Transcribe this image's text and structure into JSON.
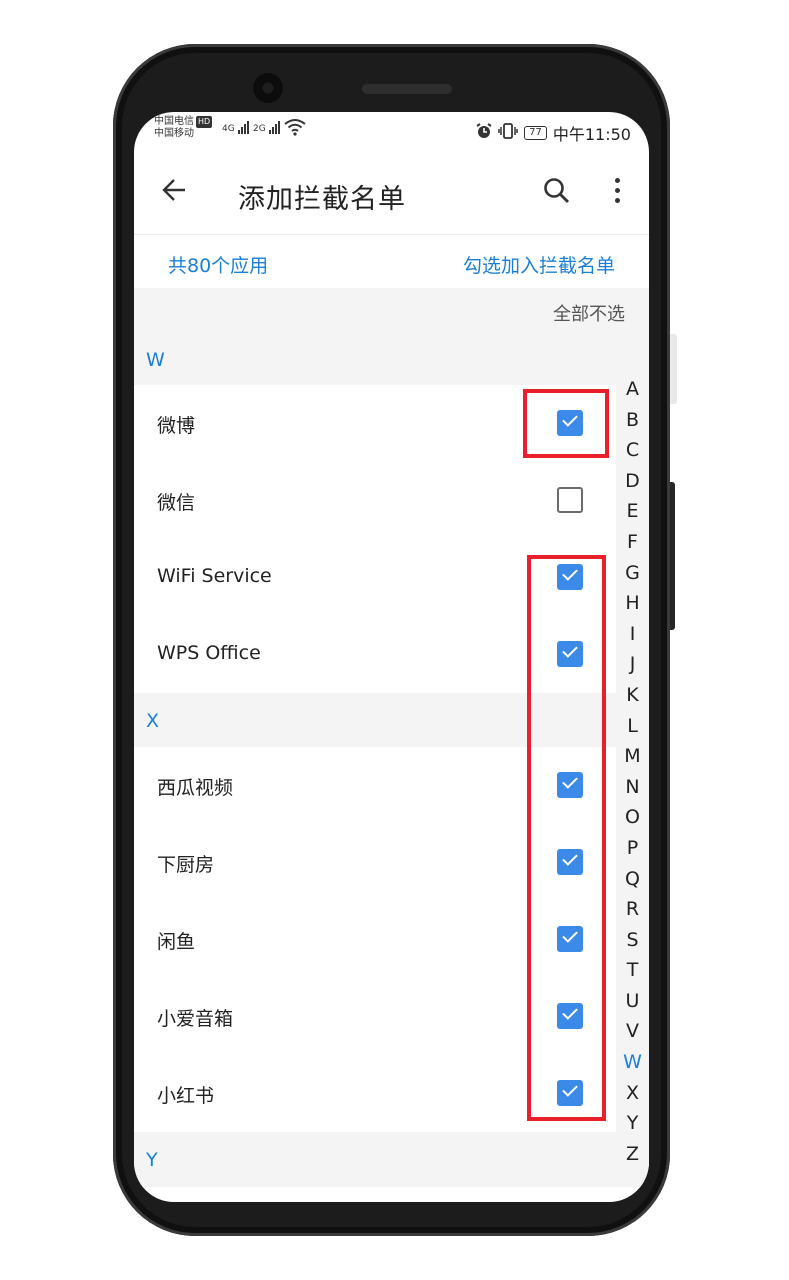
{
  "status_bar": {
    "carrier1": "中国电信",
    "carrier2": "中国移动",
    "hd": "HD",
    "net1": "4G",
    "net2": "2G",
    "battery": "77",
    "time": "中午11:50"
  },
  "app_bar": {
    "back_icon": "arrow-left-icon",
    "title": "添加拦截名单",
    "search_icon": "search-icon",
    "more_icon": "more-vert-icon"
  },
  "info": {
    "count": "共80个应用",
    "action": "勾选加入拦截名单",
    "unselect_all": "全部不选"
  },
  "sections": [
    {
      "letter": "W",
      "apps": [
        {
          "name": "微博",
          "checked": true
        },
        {
          "name": "微信",
          "checked": false
        },
        {
          "name": "WiFi Service",
          "checked": true
        },
        {
          "name": "WPS Office",
          "checked": true
        }
      ]
    },
    {
      "letter": "X",
      "apps": [
        {
          "name": "西瓜视频",
          "checked": true
        },
        {
          "name": "下厨房",
          "checked": true
        },
        {
          "name": "闲鱼",
          "checked": true
        },
        {
          "name": "小爱音箱",
          "checked": true
        },
        {
          "name": "小红书",
          "checked": true
        }
      ]
    },
    {
      "letter": "Y",
      "apps": []
    }
  ],
  "alphabet_index": [
    "A",
    "B",
    "C",
    "D",
    "E",
    "F",
    "G",
    "H",
    "I",
    "J",
    "K",
    "L",
    "M",
    "N",
    "O",
    "P",
    "Q",
    "R",
    "S",
    "T",
    "U",
    "V",
    "W",
    "X",
    "Y",
    "Z"
  ],
  "alphabet_active": "W",
  "colors": {
    "accent": "#1b7fd6",
    "checkbox_checked": "#3b89e8",
    "annotation_red": "#e8202a",
    "section_bg": "#f4f4f4"
  }
}
